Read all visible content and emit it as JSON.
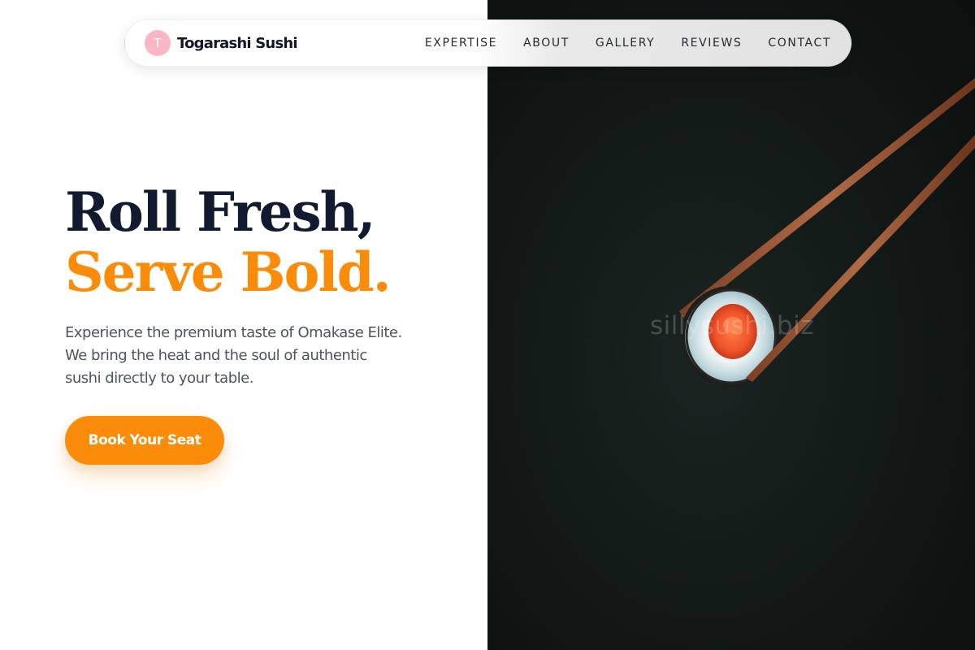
{
  "brand": {
    "logo_letter": "T",
    "name": "Togarashi Sushi"
  },
  "nav": {
    "links": [
      {
        "label": "EXPERTISE"
      },
      {
        "label": "ABOUT"
      },
      {
        "label": "GALLERY"
      },
      {
        "label": "REVIEWS"
      },
      {
        "label": "CONTACT"
      }
    ]
  },
  "hero": {
    "title_line_1": "Roll Fresh,",
    "title_line_2": "Serve Bold.",
    "subtitle": "Experience the premium taste of Omakase Elite. We bring the heat and the soul of authentic sushi directly to your table.",
    "cta_label": "Book Your Seat"
  },
  "photo": {
    "watermark": "sillysushi.biz",
    "subject": "sushi-roll-with-chopsticks"
  },
  "colors": {
    "accent": "#fb8c0a",
    "heading": "#111a2e",
    "body_text": "#4b5563",
    "logo_badge": "#fbb6c4",
    "photo_background": "#111816"
  }
}
